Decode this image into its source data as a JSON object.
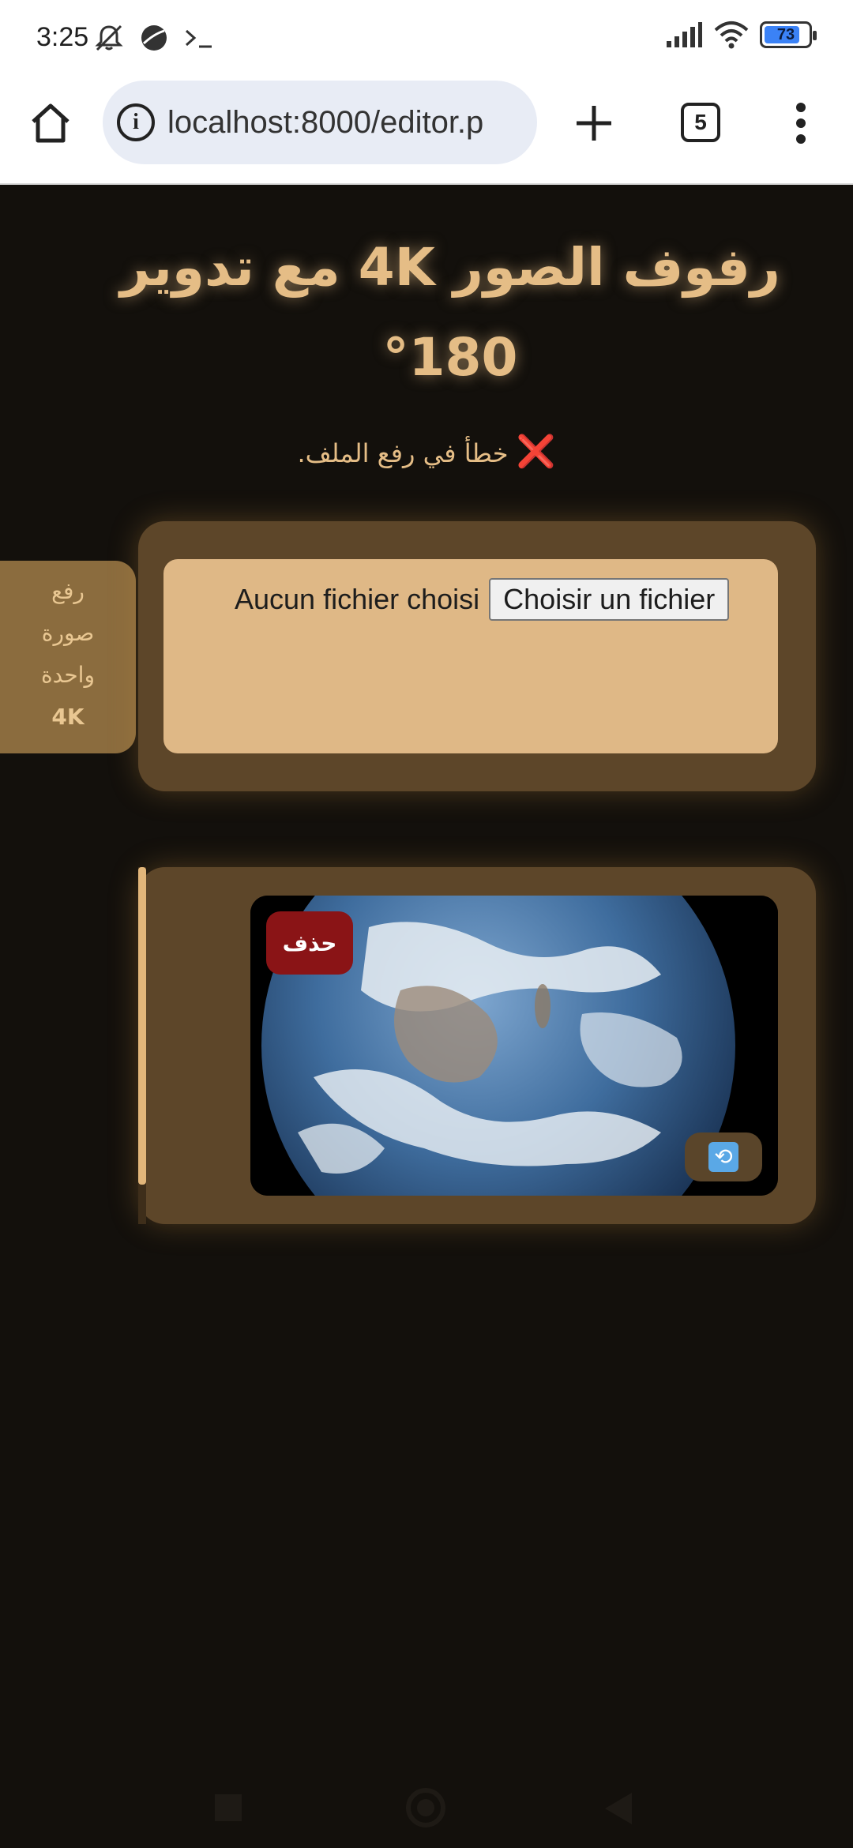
{
  "status_bar": {
    "time": "3:25",
    "battery": "73",
    "battery_level": 0.73,
    "icons": [
      "mute-icon",
      "vpn-icon",
      "terminal-icon",
      "signal-icon",
      "wifi-icon",
      "battery-icon"
    ]
  },
  "browser": {
    "url": "localhost:8000/editor.p",
    "tab_count": "5",
    "icons": [
      "home-icon",
      "info-icon",
      "plus-icon",
      "tabs-icon",
      "more-menu-icon"
    ]
  },
  "page": {
    "title": "رفوف الصور 4K مع تدوير 180°",
    "error_icon": "❌",
    "error_message": "خطأ في رفع الملف.",
    "side_button": {
      "line1": "رفع",
      "line2": "صورة",
      "line3": "واحدة",
      "line4": "4K"
    },
    "upload": {
      "file_button": "Choisir un fichier",
      "file_status": "Aucun fichier choisi"
    },
    "gallery": {
      "delete_label": "حذف",
      "rotate_icon": "🔄"
    }
  },
  "colors": {
    "background": "#13100c",
    "accent": "#e5bd86",
    "card": "#5d4629",
    "upload_area": "#dfb886",
    "delete": "#8a1416"
  }
}
